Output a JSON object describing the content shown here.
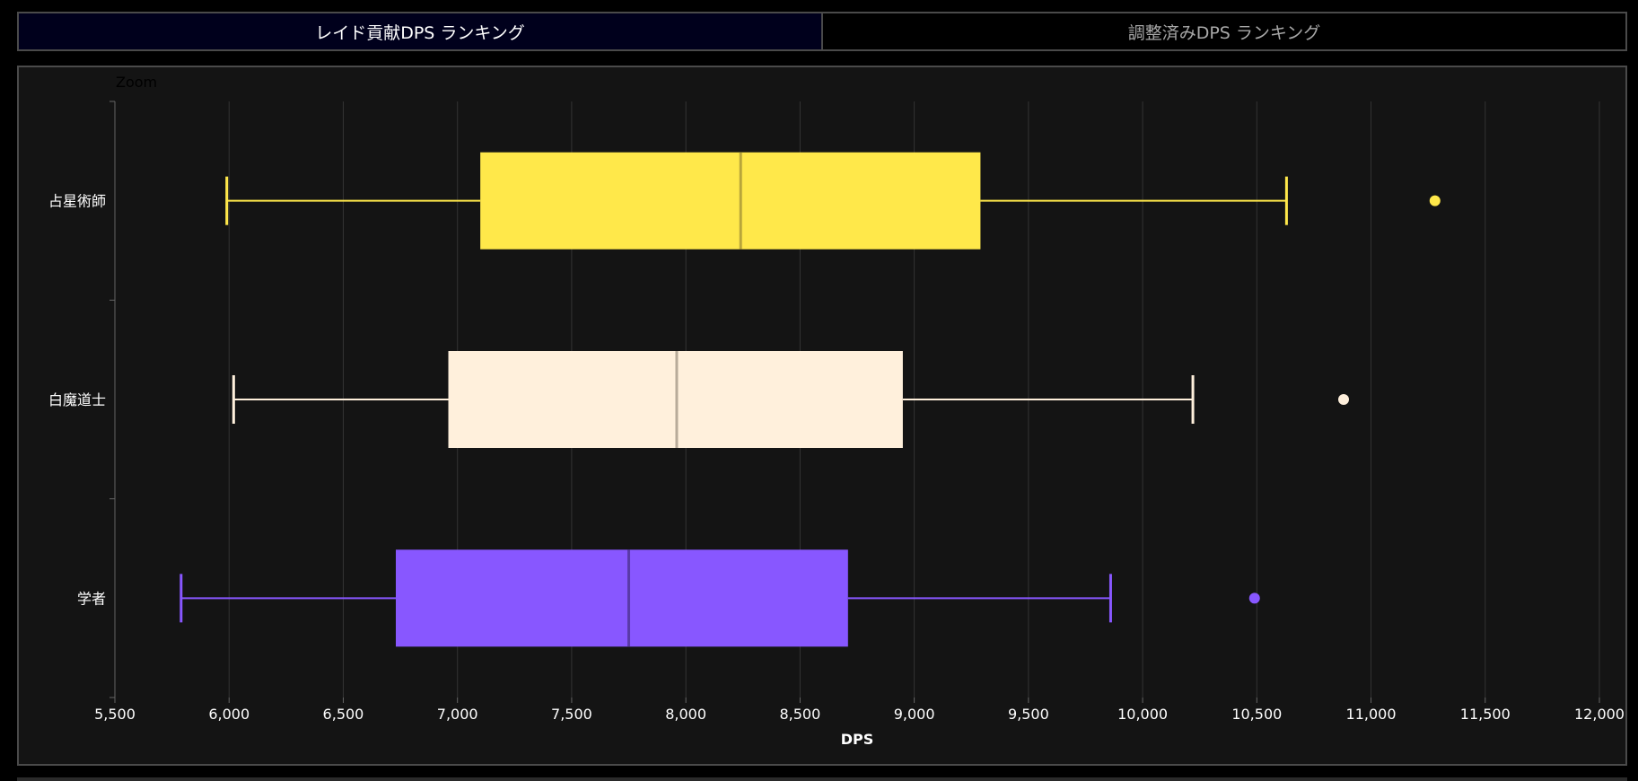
{
  "tabs": [
    {
      "label": "レイド貢献DPS ランキング",
      "active": true
    },
    {
      "label": "調整済みDPS ランキング",
      "active": false
    }
  ],
  "zoom_label": "Zoom",
  "chart_data": {
    "type": "boxplot",
    "orientation": "horizontal",
    "xlabel": "DPS",
    "xlim": [
      5500,
      12000
    ],
    "xticks": [
      5500,
      6000,
      6500,
      7000,
      7500,
      8000,
      8500,
      9000,
      9500,
      10000,
      10500,
      11000,
      11500,
      12000
    ],
    "xtick_labels": [
      "5,500",
      "6,000",
      "6,500",
      "7,000",
      "7,500",
      "8,000",
      "8,500",
      "9,000",
      "9,500",
      "10,000",
      "10,500",
      "11,000",
      "11,500",
      "12,000"
    ],
    "grid": true,
    "categories": [
      "占星術師",
      "白魔道士",
      "学者"
    ],
    "series": [
      {
        "label": "占星術師",
        "color": "#ffe84a",
        "median_color": "#b8a53a",
        "min": 5990,
        "q1": 7100,
        "median": 8240,
        "q3": 9290,
        "max": 10630,
        "outliers": [
          11280
        ]
      },
      {
        "label": "白魔道士",
        "color": "#fff0dc",
        "median_color": "#b8ab9a",
        "min": 6020,
        "q1": 6960,
        "median": 7960,
        "q3": 8950,
        "max": 10220,
        "outliers": [
          10880
        ]
      },
      {
        "label": "学者",
        "color": "#8857ff",
        "median_color": "#5a3aa8",
        "min": 5790,
        "q1": 6730,
        "median": 7750,
        "q3": 8710,
        "max": 9860,
        "outliers": [
          10490
        ]
      }
    ]
  },
  "colors": {
    "background": "#000000",
    "panel_bg": "#141414",
    "grid": "#333333",
    "axis": "#666666",
    "text": "#ffffff"
  }
}
